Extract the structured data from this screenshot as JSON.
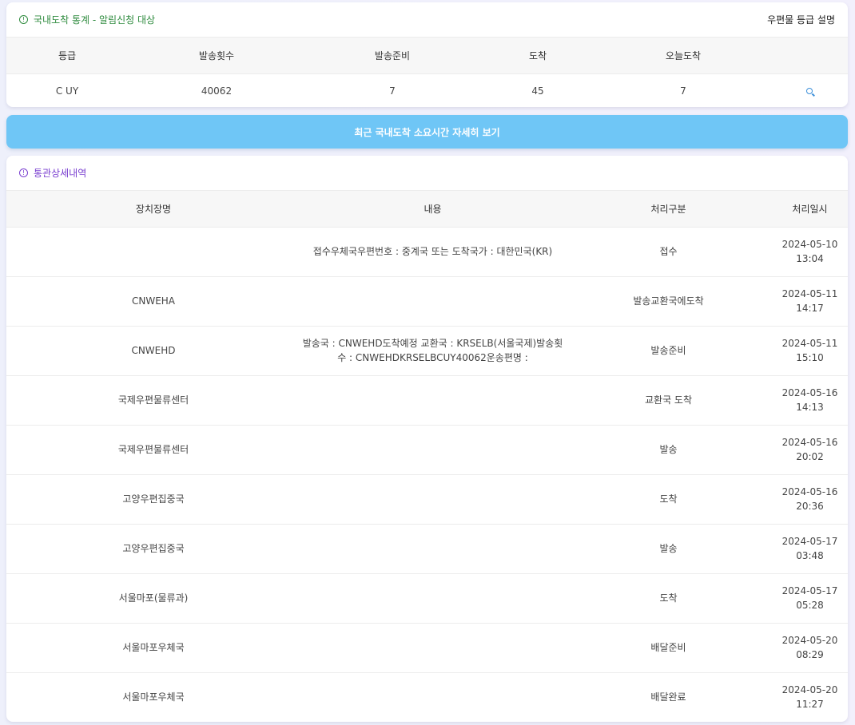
{
  "stats_card": {
    "title": "국내도착 통계 - 알림신청 대상",
    "grade_help_link": "우편물 등급 설명",
    "headers": [
      "등급",
      "발송횟수",
      "발송준비",
      "도착",
      "오늘도착",
      ""
    ],
    "row": {
      "grade": "C UY",
      "send_count": "40062",
      "ready": "7",
      "arrived": "45",
      "today_arrived": "7"
    }
  },
  "detail_button": {
    "label": "최근 국내도착 소요시간 자세히 보기"
  },
  "customs_card": {
    "title": "통관상세내역",
    "headers": [
      "장치장명",
      "내용",
      "처리구분",
      "처리일시"
    ],
    "rows": [
      {
        "location": "",
        "content": "접수우체국우편번호 : 중계국 또는 도착국가 : 대한민국(KR)",
        "status": "접수",
        "date": "2024-05-10",
        "time": "13:04"
      },
      {
        "location": "CNWEHA",
        "content": "",
        "status": "발송교환국에도착",
        "date": "2024-05-11",
        "time": "14:17"
      },
      {
        "location": "CNWEHD",
        "content": "발송국 : CNWEHD도착예정 교환국 : KRSELB(서울국제)발송횟수 : CNWEHDKRSELBCUY40062운송편명 :",
        "status": "발송준비",
        "date": "2024-05-11",
        "time": "15:10"
      },
      {
        "location": "국제우편물류센터",
        "content": "",
        "status": "교환국 도착",
        "date": "2024-05-16",
        "time": "14:13"
      },
      {
        "location": "국제우편물류센터",
        "content": "",
        "status": "발송",
        "date": "2024-05-16",
        "time": "20:02"
      },
      {
        "location": "고양우편집중국",
        "content": "",
        "status": "도착",
        "date": "2024-05-16",
        "time": "20:36"
      },
      {
        "location": "고양우편집중국",
        "content": "",
        "status": "발송",
        "date": "2024-05-17",
        "time": "03:48"
      },
      {
        "location": "서울마포(물류과)",
        "content": "",
        "status": "도착",
        "date": "2024-05-17",
        "time": "05:28"
      },
      {
        "location": "서울마포우체국",
        "content": "",
        "status": "배달준비",
        "date": "2024-05-20",
        "time": "08:29"
      },
      {
        "location": "서울마포우체국",
        "content": "",
        "status": "배달완료",
        "date": "2024-05-20",
        "time": "11:27"
      }
    ]
  }
}
